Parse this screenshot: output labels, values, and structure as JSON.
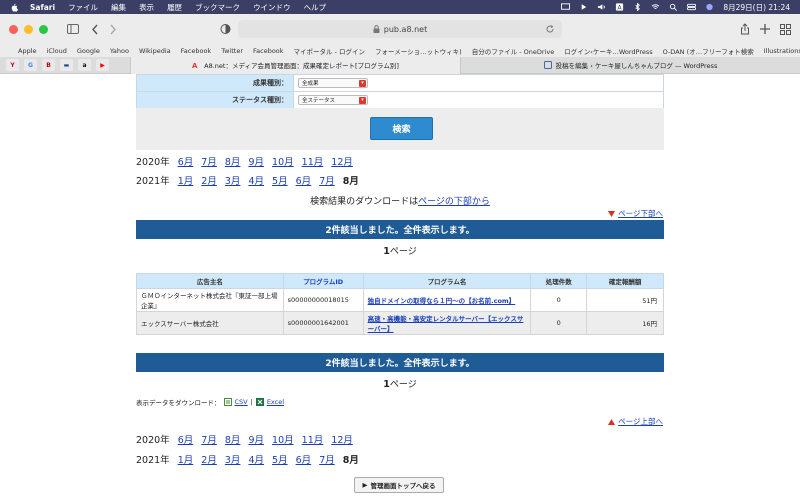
{
  "menubar": {
    "app": "Safari",
    "items": [
      "ファイル",
      "編集",
      "表示",
      "履歴",
      "ブックマーク",
      "ウインドウ",
      "ヘルプ"
    ],
    "datetime": "8月29日(日)  21:24"
  },
  "browser": {
    "url": "pub.a8.net",
    "favorites": [
      "Apple",
      "iCloud",
      "Google",
      "Yahoo",
      "Wikipedia",
      "Facebook",
      "Twitter",
      "Facebook",
      "マイポータル - ログイン",
      "フォーメーショ…ットウィキ)",
      "自分のファイル - OneDrive",
      "ログイン‹ケーキ…WordPress",
      "O-DAN (オ…フリーフォト検索",
      "Illustrations | unDraw"
    ],
    "favorites_more": "»",
    "pinned_tabs": [
      "Y",
      "G",
      "B",
      "▬",
      "a",
      "▶"
    ],
    "active_tab": "A8.net：メディア会員管理画面：成果確定レポート[プログラム別]",
    "other_tab": "投稿を編集 ‹ ケーキ屋しんちゃんブログ — WordPress"
  },
  "filters": [
    {
      "label": "成果種別：",
      "value": "全成果"
    },
    {
      "label": "ステータス種別：",
      "value": "全ステータス"
    }
  ],
  "search_button": "検索",
  "years_top": [
    {
      "year": "2020年",
      "months": [
        "6月",
        "7月",
        "8月",
        "9月",
        "10月",
        "11月",
        "12月"
      ],
      "current": ""
    },
    {
      "year": "2021年",
      "months": [
        "1月",
        "2月",
        "3月",
        "4月",
        "5月",
        "6月",
        "7月"
      ],
      "current": "8月"
    }
  ],
  "download_note": {
    "prefix": "検索結果のダウンロードは",
    "link": "ページの下部から"
  },
  "jump_bottom": "ページ下部へ",
  "jump_top": "ページ上部へ",
  "banner_text": "2件該当しました。全件表示します。",
  "page_info": {
    "num": "1",
    "suffix": "ページ"
  },
  "table": {
    "headers": [
      "広告主名",
      "プログラムID",
      "プログラム名",
      "処理件数",
      "確定報酬額"
    ],
    "rows": [
      {
        "advertiser": "ＧＭＯインターネット株式会社『東証一部上場企業』",
        "id": "s00000000018015",
        "program": "独自ドメインの取得なら１円〜の【お名前.com】",
        "count": "0",
        "amount": "51円"
      },
      {
        "advertiser": "エックスサーバー株式会社",
        "id": "s00000001642001",
        "program": "高速・高機能・高安定レンタルサーバー【エックスサーバー】",
        "count": "0",
        "amount": "16円"
      }
    ]
  },
  "download": {
    "label": "表示データをダウンロード：",
    "csv": "CSV",
    "sep": "|",
    "excel": "Excel"
  },
  "back_button": "管理画面トップへ戻る"
}
